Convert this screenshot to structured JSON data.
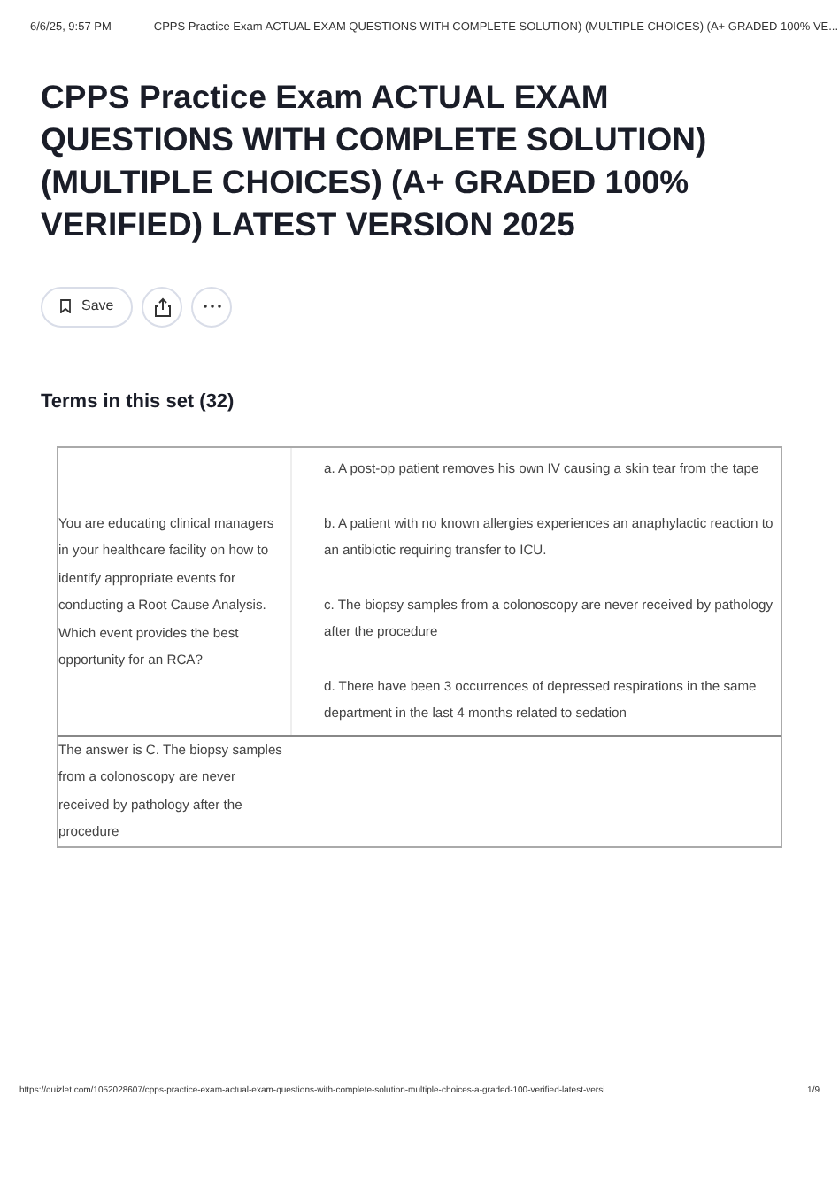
{
  "print_header": {
    "date": "6/6/25, 9:57 PM",
    "title": "CPPS Practice Exam ACTUAL EXAM QUESTIONS WITH COMPLETE SOLUTION) (MULTIPLE CHOICES) (A+ GRADED 100% VE..."
  },
  "heading": "CPPS Practice Exam ACTUAL EXAM QUESTIONS WITH COMPLETE SOLUTION) (MULTIPLE CHOICES) (A+ GRADED 100% VERIFIED) LATEST VERSION 2025",
  "actions": {
    "save": "Save"
  },
  "terms_title": "Terms in this set (32)",
  "terms": [
    {
      "question": "You are educating clinical managers in your healthcare facility on how to identify appropriate events for conducting a Root Cause Analysis. Which event provides the best opportunity for an RCA?",
      "choices": [
        "a. A post-op patient removes his own IV causing a skin tear from the tape",
        "b. A patient with no known allergies experiences an anaphylactic reaction to an antibiotic requiring transfer to ICU.",
        "c. The biopsy samples from a colonoscopy are never received by pathology after the procedure",
        "d. There have been 3 occurrences of depressed respirations in the same department in the last 4 months related to sedation"
      ]
    },
    {
      "question": "The answer is C. The biopsy samples from a colonoscopy are never received by pathology after the procedure"
    }
  ],
  "print_footer": {
    "url": "https://quizlet.com/1052028607/cpps-practice-exam-actual-exam-questions-with-complete-solution-multiple-choices-a-graded-100-verified-latest-versi...",
    "page": "1/9"
  }
}
